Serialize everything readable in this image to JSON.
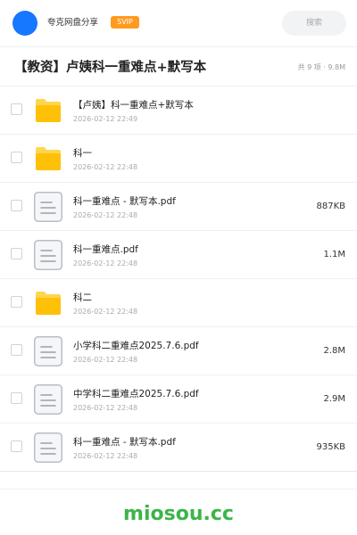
{
  "header": {
    "username": "夸克网盘分享",
    "badge": "SVIP",
    "search_placeholder": "搜索"
  },
  "share": {
    "title": "【教资】卢姨科一重难点+默写本",
    "meta": "共 9 项 · 9.8M"
  },
  "files": [
    {
      "name": "【卢姨】科一重难点+默写本",
      "date": "2026-02-12 22:49",
      "size": "",
      "type": "folder"
    },
    {
      "name": "科一",
      "date": "2026-02-12 22:48",
      "size": "",
      "type": "folder"
    },
    {
      "name": "科一重难点 - 默写本.pdf",
      "date": "2026-02-12 22:48",
      "size": "887KB",
      "type": "file"
    },
    {
      "name": "科一重难点.pdf",
      "date": "2026-02-12 22:48",
      "size": "1.1M",
      "type": "file"
    },
    {
      "name": "科二",
      "date": "2026-02-12 22:48",
      "size": "",
      "type": "folder"
    },
    {
      "name": "小学科二重难点2025.7.6.pdf",
      "date": "2026-02-12 22:48",
      "size": "2.8M",
      "type": "file"
    },
    {
      "name": "中学科二重难点2025.7.6.pdf",
      "date": "2026-02-12 22:48",
      "size": "2.9M",
      "type": "file"
    },
    {
      "name": "科一重难点 - 默写本.pdf",
      "date": "2026-02-12 22:48",
      "size": "935KB",
      "type": "file"
    }
  ],
  "icons": {
    "folder": "folder-icon",
    "file": "file-icon"
  },
  "colors": {
    "accent": "#1677ff",
    "svip": "#ff9a1f",
    "folder": "#ffc107",
    "brand": "#3cb549"
  },
  "footer": {
    "brand": "miosou.cc"
  }
}
